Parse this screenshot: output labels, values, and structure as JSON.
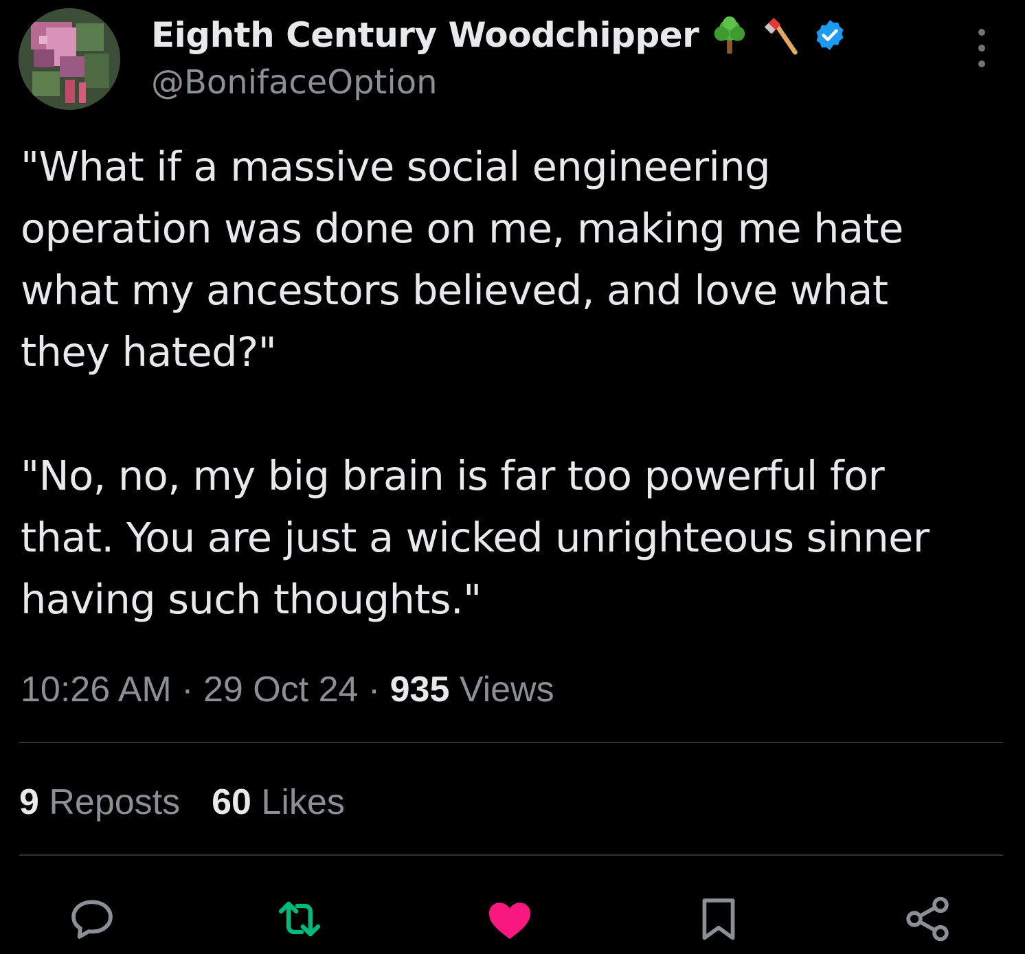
{
  "author": {
    "display_name": "Eighth Century Woodchipper",
    "handle": "@BonifaceOption",
    "badges": [
      "tree-emoji-icon",
      "axe-emoji-icon",
      "verified-badge-icon"
    ],
    "verified_color": "#1d9bf0"
  },
  "tweet": {
    "paragraph_1": "\"What if a massive social engineering\noperation was done on me, making me hate\nwhat my ancestors believed, and love what\nthey hated?\"",
    "paragraph_2": "\"No, no, my big brain is far too powerful for\nthat. You are just a wicked unrighteous sinner\nhaving such thoughts.\""
  },
  "meta": {
    "time": "10:26 AM",
    "sep1": " · ",
    "date": "29 Oct 24",
    "sep2": " · ",
    "views_count": "935",
    "views_label": " Views"
  },
  "stats": {
    "reposts_count": "9",
    "reposts_label": " Reposts",
    "likes_count": "60",
    "likes_label": " Likes"
  },
  "actions": [
    {
      "icon": "reply-icon",
      "active": false
    },
    {
      "icon": "repost-icon",
      "active": true,
      "color": "#00ba7c"
    },
    {
      "icon": "like-icon",
      "active": true,
      "color": "#f91880"
    },
    {
      "icon": "bookmark-icon",
      "active": false
    },
    {
      "icon": "share-icon",
      "active": false
    }
  ],
  "colors": {
    "background": "#000000",
    "text": "#e7e9ea",
    "secondary": "#8b9096",
    "divider": "#2f3336"
  }
}
